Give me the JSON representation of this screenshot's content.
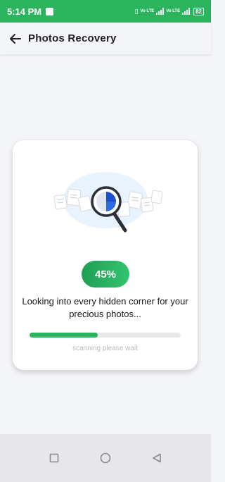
{
  "status_bar": {
    "time": "5:14 PM",
    "network_label_1": "Vo LTE",
    "network_label_2": "Vo LTE",
    "battery": "82"
  },
  "header": {
    "back_icon": "arrow-left-icon",
    "title": "Photos Recovery"
  },
  "scan_card": {
    "illustration_icon": "magnifier-documents-icon",
    "percent_label": "45%",
    "progress_fraction": 0.45,
    "message": "Looking into every hidden corner for your precious photos...",
    "hint": "scanning please wait"
  },
  "nav_bar": {
    "items": [
      {
        "icon": "square-recents-icon"
      },
      {
        "icon": "circle-home-icon"
      },
      {
        "icon": "triangle-back-icon"
      }
    ]
  },
  "colors": {
    "accent": "#2bb35e",
    "track": "#e6e8ea"
  }
}
